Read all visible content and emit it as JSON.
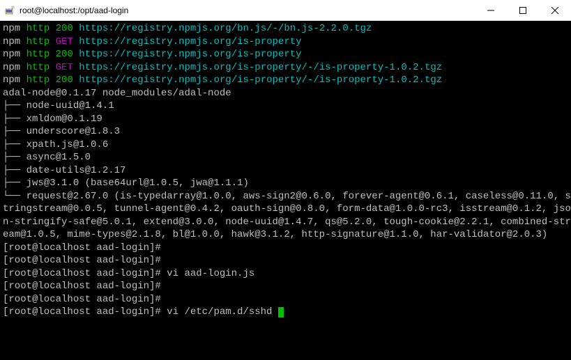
{
  "window": {
    "title": "root@localhost:/opt/aad-login"
  },
  "npm_lines": [
    {
      "word1": "npm",
      "word2": "http",
      "word3": "200",
      "url": "https://registry.npmjs.org/bn.js/-/bn.js-2.2.0.tgz"
    },
    {
      "word1": "npm",
      "word2": "http",
      "word3": "GET",
      "url": "https://registry.npmjs.org/is-property"
    },
    {
      "word1": "npm",
      "word2": "http",
      "word3": "200",
      "url": "https://registry.npmjs.org/is-property"
    },
    {
      "word1": "npm",
      "word2": "http",
      "word3": "GET",
      "url": "https://registry.npmjs.org/is-property/-/is-property-1.0.2.tgz"
    },
    {
      "word1": "npm",
      "word2": "http",
      "word3": "200",
      "url": "https://registry.npmjs.org/is-property/-/is-property-1.0.2.tgz"
    }
  ],
  "pkg_header": "adal-node@0.1.17 node_modules/adal-node",
  "deps": [
    "node-uuid@1.4.1",
    "xmldom@0.1.19",
    "underscore@1.8.3",
    "xpath.js@1.0.6",
    "async@1.5.0",
    "date-utils@1.2.17",
    "jws@3.1.0 (base64url@1.0.5, jwa@1.1.1)"
  ],
  "dep_last_prefix": "└── ",
  "dep_mid_prefix": "├── ",
  "dep_last_wrap": "request@2.67.0 (is-typedarray@1.0.0, aws-sign2@0.6.0, forever-agent@0.6.1, caseless@0.11.0, stringstream@0.0.5, tunnel-agent@0.4.2, oauth-sign@0.8.0, form-data@1.0.0-rc3, isstream@0.1.2, json-stringify-safe@5.0.1, extend@3.0.0, node-uuid@1.4.7, qs@5.2.0, tough-cookie@2.2.1, combined-stream@1.0.5, mime-types@2.1.8, bl@1.0.0, hawk@3.1.2, http-signature@1.1.0, har-validator@2.0.3)",
  "prompts": [
    {
      "prompt": "[root@localhost aad-login]#",
      "cmd": ""
    },
    {
      "prompt": "[root@localhost aad-login]#",
      "cmd": ""
    },
    {
      "prompt": "[root@localhost aad-login]#",
      "cmd": " vi aad-login.js"
    },
    {
      "prompt": "[root@localhost aad-login]#",
      "cmd": ""
    },
    {
      "prompt": "[root@localhost aad-login]#",
      "cmd": ""
    },
    {
      "prompt": "[root@localhost aad-login]#",
      "cmd": " vi /etc/pam.d/sshd "
    }
  ]
}
